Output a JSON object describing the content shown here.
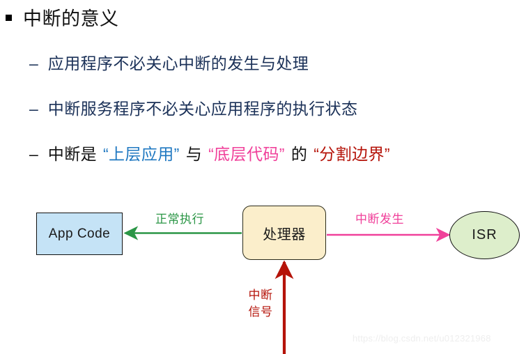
{
  "slide": {
    "heading": {
      "bullet": "square-bullet",
      "text": "中断的意义"
    },
    "bullets": [
      {
        "dash": "–",
        "text": "应用程序不必关心中断的发生与处理"
      },
      {
        "dash": "–",
        "text": "中断服务程序不必关心应用程序的执行状态"
      }
    ],
    "bullet3": {
      "dash": "–",
      "part1": "中断是",
      "quote_blue": "“上层应用”",
      "part2": "与",
      "quote_pink": "“底层代码”",
      "part3": "的",
      "quote_red": "“分割边界”"
    },
    "diagram": {
      "nodes": {
        "app_code": "App Code",
        "processor": "处理器",
        "isr": "ISR"
      },
      "labels": {
        "normal_exec": "正常执行",
        "interrupt_occurs": "中断发生",
        "interrupt_signal_line1": "中断",
        "interrupt_signal_line2": "信号"
      }
    },
    "watermark": "https://blog.csdn.net/u012321968",
    "colors": {
      "bullet_text": "#1b3158",
      "quote_blue": "#1f78c1",
      "quote_pink": "#f0409a",
      "quote_red": "#b51309",
      "arrow_green": "#2b9646",
      "arrow_pink": "#f0409a",
      "arrow_red": "#b51309",
      "app_code_fill": "#c5e3f6",
      "processor_fill": "#fbeecb",
      "isr_fill": "#ddeecb"
    }
  }
}
